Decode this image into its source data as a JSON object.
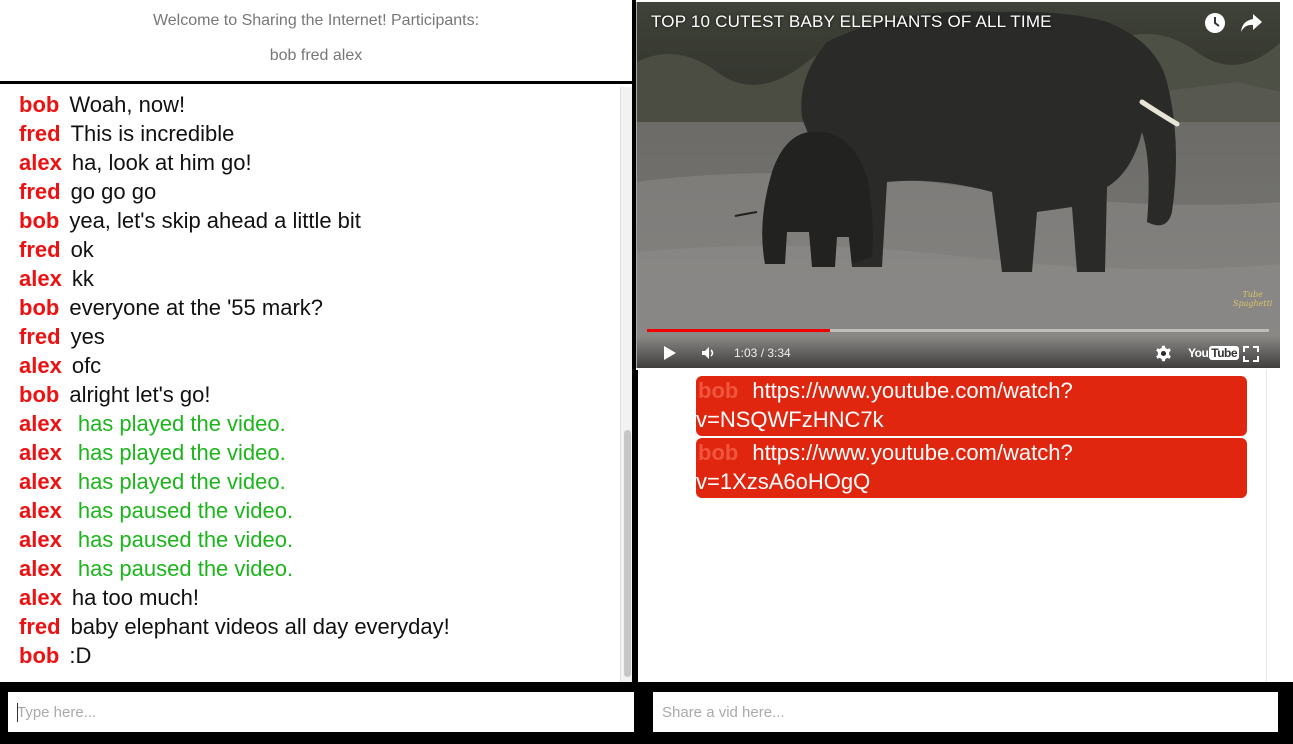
{
  "header": {
    "welcome": "Welcome to Sharing the Internet! Participants:",
    "participants": "bob fred alex"
  },
  "chat": {
    "messages": [
      {
        "user": "bob",
        "text": "Woah, now!",
        "type": "message"
      },
      {
        "user": "fred",
        "text": "This is incredible",
        "type": "message"
      },
      {
        "user": "alex",
        "text": "ha, look at him go!",
        "type": "message"
      },
      {
        "user": "fred",
        "text": "go go go",
        "type": "message"
      },
      {
        "user": "bob",
        "text": "yea, let's skip ahead a little bit",
        "type": "message"
      },
      {
        "user": "fred",
        "text": "ok",
        "type": "message"
      },
      {
        "user": "alex",
        "text": "kk",
        "type": "message"
      },
      {
        "user": "bob",
        "text": "everyone at the '55 mark?",
        "type": "message"
      },
      {
        "user": "fred",
        "text": "yes",
        "type": "message"
      },
      {
        "user": "alex",
        "text": "ofc",
        "type": "message"
      },
      {
        "user": "bob",
        "text": "alright let's go!",
        "type": "message"
      },
      {
        "user": "alex",
        "text": "has played the video.",
        "type": "event"
      },
      {
        "user": "alex",
        "text": "has played the video.",
        "type": "event"
      },
      {
        "user": "alex",
        "text": "has played the video.",
        "type": "event"
      },
      {
        "user": "alex",
        "text": "has paused the video.",
        "type": "event"
      },
      {
        "user": "alex",
        "text": "has paused the video.",
        "type": "event"
      },
      {
        "user": "alex",
        "text": "has paused the video.",
        "type": "event"
      },
      {
        "user": "alex",
        "text": "ha too much!",
        "type": "message"
      },
      {
        "user": "fred",
        "text": "baby elephant videos all day everyday!",
        "type": "message"
      },
      {
        "user": "bob",
        "text": ":D",
        "type": "message"
      }
    ]
  },
  "player": {
    "title": "TOP 10 CUTEST BABY ELEPHANTS OF ALL TIME",
    "time": "1:03 / 3:34",
    "progress": 0.294,
    "youtube_logo": "You",
    "youtube_logo_tube": "Tube",
    "watermark_line1": "Tube",
    "watermark_line2": "Spaghetti",
    "icons": [
      "clock-icon",
      "share-icon",
      "play-icon",
      "volume-icon",
      "settings-icon",
      "fullscreen-icon"
    ]
  },
  "shared_links": [
    {
      "user": "bob",
      "url": "https://www.youtube.com/watch?v=NSQWFzHNC7k",
      "line1": "https://www.youtube.com/watch?",
      "line2": "v=NSQWFzHNC7k"
    },
    {
      "user": "bob",
      "url": "https://www.youtube.com/watch?v=1XzsA6oHOgQ",
      "line1": "https://www.youtube.com/watch?",
      "line2": "v=1XzsA6oHOgQ"
    }
  ],
  "inputs": {
    "chat_placeholder": "Type here...",
    "video_placeholder": "Share a vid here..."
  },
  "colors": {
    "username": "#e11111",
    "event_text": "#1cb51c",
    "link_card": "#e0260f",
    "progress": "#ee0000"
  }
}
